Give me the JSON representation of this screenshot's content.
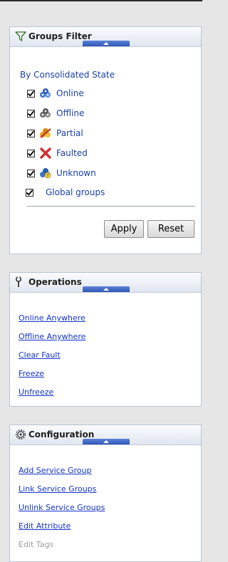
{
  "groups_filter": {
    "title": "Groups Filter",
    "icon": "funnel-icon",
    "section_label": "By Consolidated State",
    "states": [
      {
        "label": "Online",
        "checked": true,
        "icon": "online-icon"
      },
      {
        "label": "Offline",
        "checked": true,
        "icon": "offline-icon"
      },
      {
        "label": "Partial",
        "checked": true,
        "icon": "partial-icon"
      },
      {
        "label": "Faulted",
        "checked": true,
        "icon": "faulted-icon"
      },
      {
        "label": "Unknown",
        "checked": true,
        "icon": "unknown-icon"
      }
    ],
    "global_groups": {
      "label": "Global groups",
      "checked": true
    },
    "apply_label": "Apply",
    "reset_label": "Reset"
  },
  "operations": {
    "title": "Operations",
    "icon": "wrench-icon",
    "links": [
      {
        "label": "Online Anywhere",
        "enabled": true
      },
      {
        "label": "Offline Anywhere",
        "enabled": true
      },
      {
        "label": "Clear Fault",
        "enabled": true
      },
      {
        "label": "Freeze",
        "enabled": true
      },
      {
        "label": "Unfreeze",
        "enabled": true
      }
    ]
  },
  "configuration": {
    "title": "Configuration",
    "icon": "gear-icon",
    "links": [
      {
        "label": "Add Service Group",
        "enabled": true
      },
      {
        "label": "Link Service Groups",
        "enabled": true
      },
      {
        "label": "Unlink Service Groups",
        "enabled": true
      },
      {
        "label": "Edit Attribute",
        "enabled": true
      },
      {
        "label": "Edit Tags",
        "enabled": false
      }
    ]
  },
  "colors": {
    "link": "#1434c8",
    "label_blue": "#1b3fa8",
    "disabled": "#9e9e9e",
    "collapse_tab": "#2f56b6"
  }
}
